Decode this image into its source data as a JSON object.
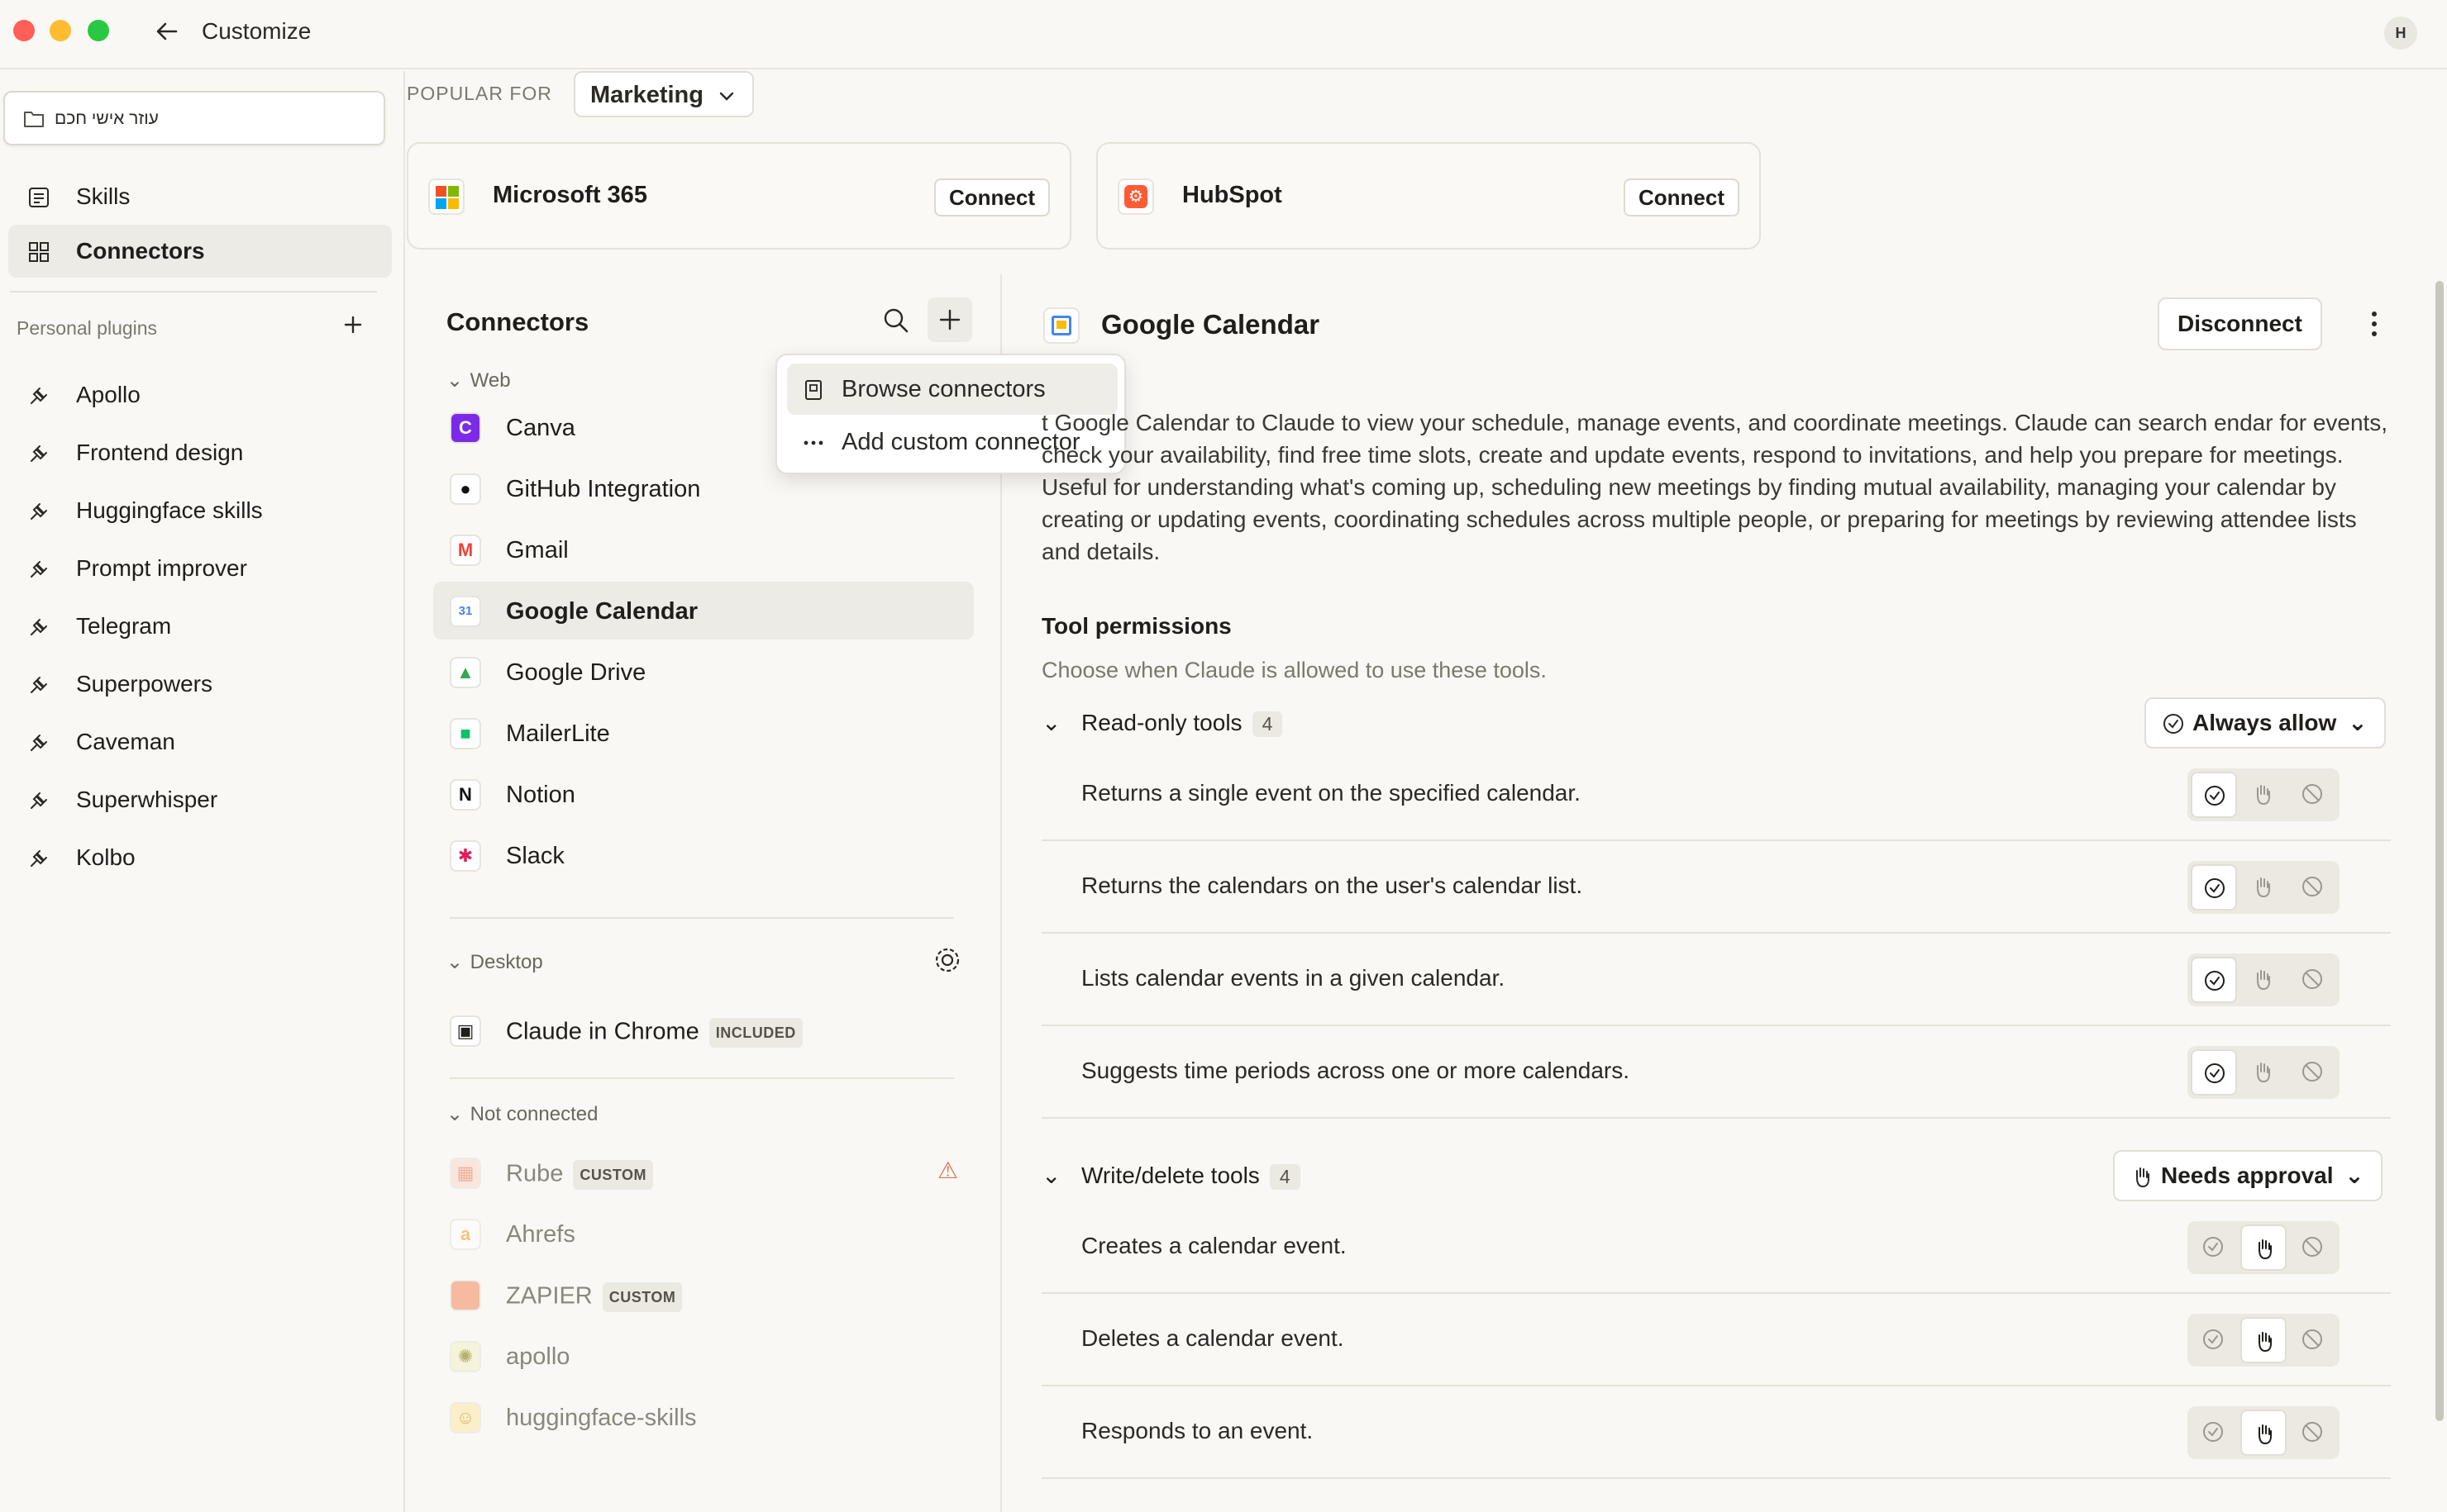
{
  "window": {
    "title": "Customize",
    "avatar": "H"
  },
  "sidebar": {
    "project_label": "עוזר אישי חכם",
    "items": [
      {
        "label": "Skills",
        "icon": "skills-icon"
      },
      {
        "label": "Connectors",
        "icon": "connectors-icon",
        "selected": true
      }
    ],
    "plugins_title": "Personal plugins",
    "plugins": [
      "Apollo",
      "Frontend design",
      "Huggingface skills",
      "Prompt improver",
      "Telegram",
      "Superpowers",
      "Caveman",
      "Superwhisper",
      "Kolbo"
    ]
  },
  "popular": {
    "label": "POPULAR FOR",
    "selected": "Marketing",
    "cards": [
      {
        "name": "Microsoft 365",
        "button": "Connect"
      },
      {
        "name": "HubSpot",
        "button": "Connect"
      }
    ]
  },
  "connectors": {
    "title": "Connectors",
    "groups": {
      "web": "Web",
      "desktop": "Desktop",
      "not_connected": "Not connected"
    },
    "web": [
      "Canva",
      "GitHub Integration",
      "Gmail",
      "Google Calendar",
      "Google Drive",
      "MailerLite",
      "Notion",
      "Slack"
    ],
    "desktop": [
      {
        "name": "Claude in Chrome",
        "badge": "INCLUDED"
      }
    ],
    "not_connected": [
      {
        "name": "Rube",
        "badge": "CUSTOM",
        "warning": true
      },
      {
        "name": "Ahrefs"
      },
      {
        "name": "ZAPIER",
        "badge": "CUSTOM"
      },
      {
        "name": "apollo"
      },
      {
        "name": "huggingface-skills"
      }
    ]
  },
  "menu": {
    "items": [
      {
        "label": "Browse connectors",
        "icon": "book-icon"
      },
      {
        "label": "Add custom connector",
        "icon": "more-dots-icon"
      }
    ]
  },
  "detail": {
    "title": "Google Calendar",
    "disconnect": "Disconnect",
    "description": "t Google Calendar to Claude to view your schedule, manage events, and coordinate meetings. Claude can search endar for events, check your availability, find free time slots, create and update events, respond to invitations, and help you prepare for meetings. Useful for understanding what's coming up, scheduling new meetings by finding mutual availability, managing your calendar by creating or updating events, coordinating schedules across multiple people, or preparing for meetings by reviewing attendee lists and details.",
    "permissions_title": "Tool permissions",
    "permissions_sub": "Choose when Claude is allowed to use these tools.",
    "sections": [
      {
        "title": "Read-only tools",
        "count": "4",
        "policy": "Always allow",
        "tools": [
          "Returns a single event on the specified calendar.",
          "Returns the calendars on the user's calendar list.",
          "Lists calendar events in a given calendar.",
          "Suggests time periods across one or more calendars."
        ]
      },
      {
        "title": "Write/delete tools",
        "count": "4",
        "policy": "Needs approval",
        "tools": [
          "Creates a calendar event.",
          "Deletes a calendar event.",
          "Responds to an event."
        ]
      }
    ]
  },
  "colors": {
    "accent": "#d97757",
    "background": "#f9f8f4",
    "selected": "#edebe5"
  }
}
